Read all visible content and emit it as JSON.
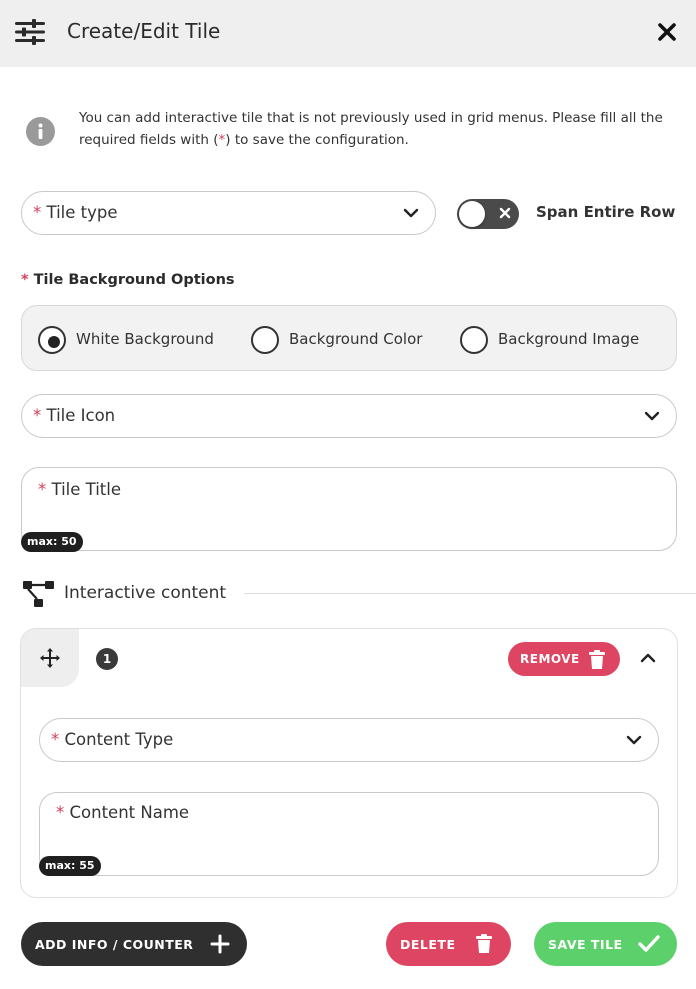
{
  "header": {
    "title": "Create/Edit Tile",
    "icon": "sliders-icon",
    "close_icon": "close-icon"
  },
  "info": {
    "text_before": "You can add interactive tile that is not previously used in grid menus. Please fill all the required fields with (",
    "required_mark": "*",
    "text_after": ") to save the configuration."
  },
  "form": {
    "required_mark": "*",
    "tile_type": {
      "label": "Tile type"
    },
    "span_toggle": {
      "label": "Span Entire Row",
      "on": false
    },
    "background": {
      "label": "Tile Background Options",
      "options": [
        {
          "label": "White Background",
          "selected": true
        },
        {
          "label": "Background Color",
          "selected": false
        },
        {
          "label": "Background Image",
          "selected": false
        }
      ]
    },
    "tile_icon": {
      "label": "Tile Icon"
    },
    "tile_title": {
      "label": "Tile Title",
      "max": "max: 50"
    }
  },
  "interactive": {
    "title": "Interactive content",
    "item": {
      "number": "1",
      "remove_label": "REMOVE",
      "content_type": {
        "label": "Content Type"
      },
      "content_name": {
        "label": "Content Name",
        "max": "max: 55"
      }
    }
  },
  "footer": {
    "add_label": "ADD INFO / COUNTER",
    "delete_label": "DELETE",
    "save_label": "SAVE TILE"
  },
  "colors": {
    "header_bg": "#efefef",
    "danger": "#dd4563",
    "success": "#5cd16b",
    "dark": "#2f2f2f",
    "required": "#d6405a"
  }
}
